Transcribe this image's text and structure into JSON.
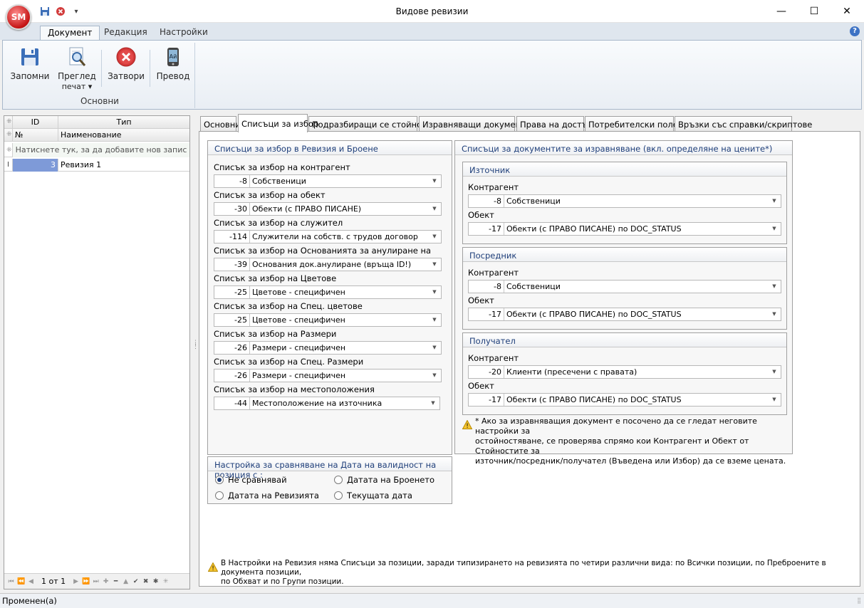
{
  "app": {
    "logo_text": "SM",
    "title": "Видове ревизии"
  },
  "window_controls": {
    "minimize": "—",
    "maximize": "☐",
    "close": "✕",
    "qat_more": "▾"
  },
  "ribbon": {
    "tabs": [
      "Документ",
      "Редакция",
      "Настройки"
    ],
    "buttons": {
      "save": "Запомни",
      "preview_line1": "Преглед",
      "preview_line2": "печат ▾",
      "close": "Затвори",
      "translate": "Превод"
    },
    "group_label": "Основни"
  },
  "left_grid": {
    "col_id": "ID",
    "col_type": "Тип",
    "col_no": "№",
    "col_name": "Наименование",
    "new_row_hint": "Натиснете тук, за да добавите нов запис",
    "rows": [
      {
        "id": "3",
        "name": "Ревизия 1"
      }
    ],
    "pager": "1 от 1"
  },
  "tabs": [
    "Основни",
    "Списъци за избор",
    "Подразбиращи се стойности",
    "Изравняващи документи",
    "Права на достъп",
    "Потребителски полета",
    "Връзки със справки/скриптове"
  ],
  "lists_group": {
    "title": "Списъци за избор в Ревизия и Броене",
    "items": [
      {
        "label": "Списък за избор на контрагент",
        "id": "-8",
        "value": "Собственици"
      },
      {
        "label": "Списък за избор на обект",
        "id": "-30",
        "value": "Обекти (с ПРАВО ПИСАНЕ)"
      },
      {
        "label": "Списък за избор на служител",
        "id": "-114",
        "value": "Служители на собств. с трудов договор"
      },
      {
        "label": "Списък за избор на Основанията за анулиране на ревизията",
        "id": "-39",
        "value": "Основания док.анулиране (връща ID!)"
      },
      {
        "label": "Списък за избор на Цветове",
        "id": "-25",
        "value": "Цветове - специфичен"
      },
      {
        "label": "Списък за избор на Спец. цветове",
        "id": "-25",
        "value": "Цветове - специфичен"
      },
      {
        "label": "Списък за избор на Размери",
        "id": "-26",
        "value": "Размери - специфичен"
      },
      {
        "label": "Списък за избор на Спец. Размери",
        "id": "-26",
        "value": "Размери - специфичен"
      },
      {
        "label": "Списък за избор на местоположения",
        "id": "-44",
        "value": "Местоположение на източника"
      }
    ]
  },
  "date_group": {
    "title": "Настройка за сравняване на Дата на валидност на позиция с :",
    "options": [
      "Не сравнявай",
      "Датата на Броенето",
      "Датата на Ревизията",
      "Текущата дата"
    ],
    "selected": "Не сравнявай"
  },
  "equalizing_group": {
    "title": "Списъци за документите за изравняване (вкл. определяне на цените*)",
    "sections": [
      {
        "title": "Източник",
        "contractor_label": "Контрагент",
        "contractor_id": "-8",
        "contractor_value": "Собственици",
        "object_label": "Обект",
        "object_id": "-17",
        "object_value": "Обекти (с ПРАВО ПИСАНЕ) по DOC_STATUS"
      },
      {
        "title": "Посредник",
        "contractor_label": "Контрагент",
        "contractor_id": "-8",
        "contractor_value": "Собственици",
        "object_label": "Обект",
        "object_id": "-17",
        "object_value": "Обекти (с ПРАВО ПИСАНЕ) по DOC_STATUS"
      },
      {
        "title": "Получател",
        "contractor_label": "Контрагент",
        "contractor_id": "-20",
        "contractor_value": "Клиенти (пресечени с правата)",
        "object_label": "Обект",
        "object_id": "-17",
        "object_value": "Обекти (с ПРАВО ПИСАНЕ) по DOC_STATUS"
      }
    ],
    "note_lines": [
      "* Ако за изравняващия документ е посочено да се гледат неговите настройки за",
      "остойностяване, се проверява спрямо кои Контрагент и Обект от Стойностите за",
      "източник/посредник/получател (Въведена или Избор) да се вземе цената."
    ]
  },
  "bottom_note_lines": [
    "В Настройки на Ревизия няма Списъци за позиции, заради типизирането на ревизията по четири различни вида: по Всички позиции, по Преброените в документа позиции,",
    "по Обхват и по Групи позиции."
  ],
  "statusbar": {
    "text": "Променен(а)"
  },
  "colors": {
    "accent": "#1f3f7a",
    "selected_row": "#7e9ad8",
    "ribbon_border": "#a8b8ca"
  }
}
